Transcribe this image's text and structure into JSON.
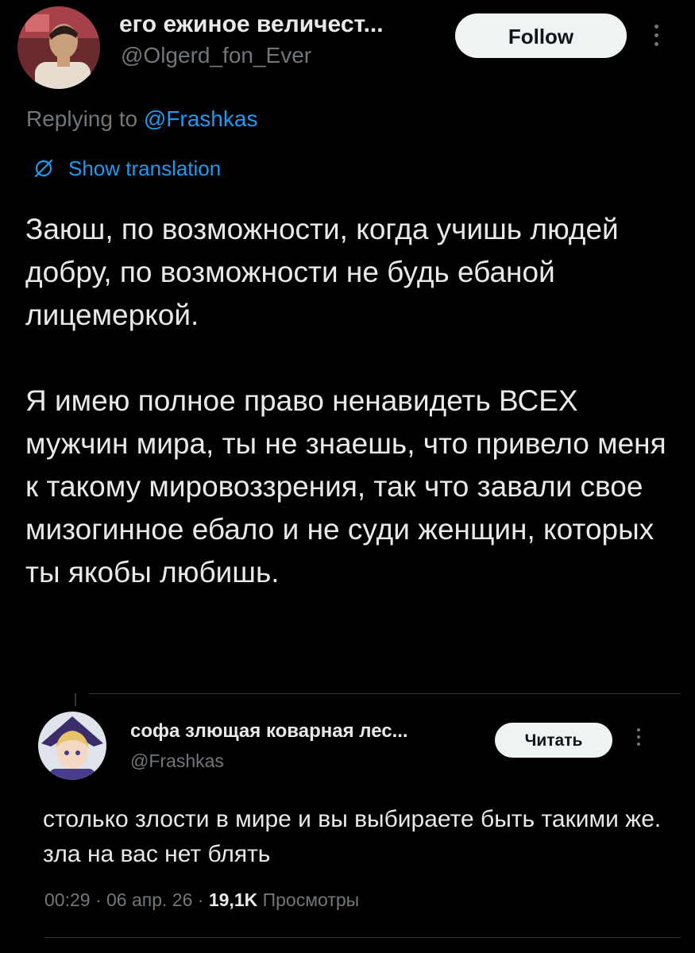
{
  "main_tweet": {
    "display_name": "его ежиное величест...",
    "handle": "@Olgerd_fon_Ever",
    "follow_label": "Follow",
    "replying_prefix": "Replying to",
    "replying_to": "@Frashkas",
    "show_translation": "Show translation",
    "body": [
      "Заюш, по возможности, когда учишь людей добру, по возможности не будь ебаной лицемеркой.",
      "Я имею полное право ненавидеть ВСЕХ мужчин мира, ты не знаешь, что привело меня к такому мировоззрения, так что завали свое мизогинное ебало и не суди женщин, которых ты якобы любишь."
    ]
  },
  "quoted_tweet": {
    "display_name": "софа злющая коварная лес...",
    "handle": "@Frashkas",
    "read_label": "Читать",
    "body": "столько злости в мире и вы выбираете быть такими же. зла на вас нет блять",
    "time": "00:29",
    "date": "06 апр. 26",
    "views_count": "19,1K",
    "views_label": "Просмотры"
  },
  "icons": {
    "translate": "globe-slash-icon",
    "more": "more-options-icon"
  },
  "colors": {
    "background": "#000000",
    "text_primary": "#e7e9ea",
    "text_secondary": "#71767b",
    "accent": "#1d9bf0",
    "button_bg": "#eff3f4"
  }
}
